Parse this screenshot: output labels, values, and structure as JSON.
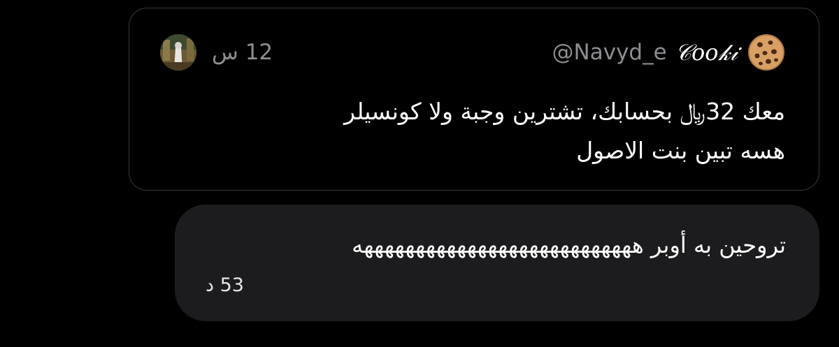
{
  "quote": {
    "author_name": "𝒞𝑜𝑜𝓀𝒾",
    "author_handle": "@Navyd_e",
    "time": "12 س",
    "avatar_icon": "cookie-icon",
    "body_line_1": "معك 32﷼ بحسابك، تشترين وجبة ولا كونسيلر",
    "body_line_2": "هسه تبين بنت الاصول"
  },
  "reply": {
    "text": "تروحين به أوبر هههههههههههههههههههههههههههه",
    "time": "53 د"
  },
  "colors": {
    "background": "#000000",
    "card_border": "#3a3a3c",
    "bubble": "#1c1c1e",
    "muted_text": "#8e8e93",
    "primary_text": "#ffffff"
  }
}
